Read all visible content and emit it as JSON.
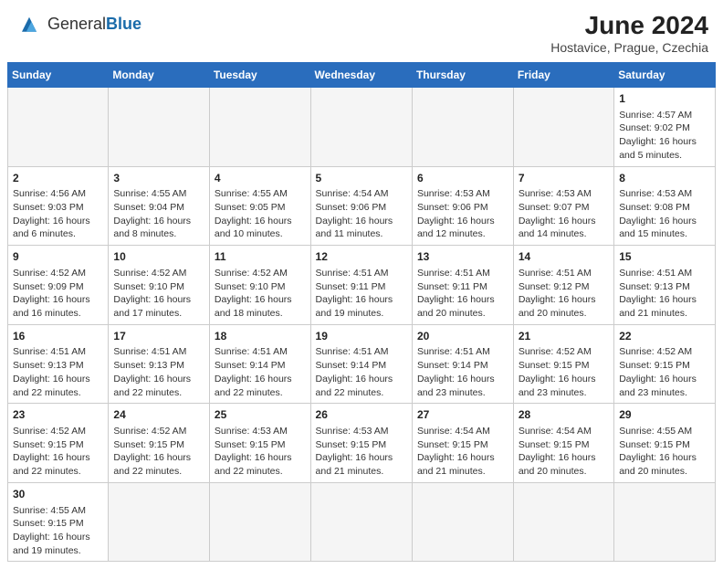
{
  "header": {
    "logo_general": "General",
    "logo_blue": "Blue",
    "month_year": "June 2024",
    "location": "Hostavice, Prague, Czechia"
  },
  "days_of_week": [
    "Sunday",
    "Monday",
    "Tuesday",
    "Wednesday",
    "Thursday",
    "Friday",
    "Saturday"
  ],
  "weeks": [
    [
      {
        "day": "",
        "info": ""
      },
      {
        "day": "",
        "info": ""
      },
      {
        "day": "",
        "info": ""
      },
      {
        "day": "",
        "info": ""
      },
      {
        "day": "",
        "info": ""
      },
      {
        "day": "",
        "info": ""
      },
      {
        "day": "1",
        "info": "Sunrise: 4:57 AM\nSunset: 9:02 PM\nDaylight: 16 hours and 5 minutes."
      }
    ],
    [
      {
        "day": "2",
        "info": "Sunrise: 4:56 AM\nSunset: 9:03 PM\nDaylight: 16 hours and 6 minutes."
      },
      {
        "day": "3",
        "info": "Sunrise: 4:55 AM\nSunset: 9:04 PM\nDaylight: 16 hours and 8 minutes."
      },
      {
        "day": "4",
        "info": "Sunrise: 4:55 AM\nSunset: 9:05 PM\nDaylight: 16 hours and 10 minutes."
      },
      {
        "day": "5",
        "info": "Sunrise: 4:54 AM\nSunset: 9:06 PM\nDaylight: 16 hours and 11 minutes."
      },
      {
        "day": "6",
        "info": "Sunrise: 4:53 AM\nSunset: 9:06 PM\nDaylight: 16 hours and 12 minutes."
      },
      {
        "day": "7",
        "info": "Sunrise: 4:53 AM\nSunset: 9:07 PM\nDaylight: 16 hours and 14 minutes."
      },
      {
        "day": "8",
        "info": "Sunrise: 4:53 AM\nSunset: 9:08 PM\nDaylight: 16 hours and 15 minutes."
      }
    ],
    [
      {
        "day": "9",
        "info": "Sunrise: 4:52 AM\nSunset: 9:09 PM\nDaylight: 16 hours and 16 minutes."
      },
      {
        "day": "10",
        "info": "Sunrise: 4:52 AM\nSunset: 9:10 PM\nDaylight: 16 hours and 17 minutes."
      },
      {
        "day": "11",
        "info": "Sunrise: 4:52 AM\nSunset: 9:10 PM\nDaylight: 16 hours and 18 minutes."
      },
      {
        "day": "12",
        "info": "Sunrise: 4:51 AM\nSunset: 9:11 PM\nDaylight: 16 hours and 19 minutes."
      },
      {
        "day": "13",
        "info": "Sunrise: 4:51 AM\nSunset: 9:11 PM\nDaylight: 16 hours and 20 minutes."
      },
      {
        "day": "14",
        "info": "Sunrise: 4:51 AM\nSunset: 9:12 PM\nDaylight: 16 hours and 20 minutes."
      },
      {
        "day": "15",
        "info": "Sunrise: 4:51 AM\nSunset: 9:13 PM\nDaylight: 16 hours and 21 minutes."
      }
    ],
    [
      {
        "day": "16",
        "info": "Sunrise: 4:51 AM\nSunset: 9:13 PM\nDaylight: 16 hours and 22 minutes."
      },
      {
        "day": "17",
        "info": "Sunrise: 4:51 AM\nSunset: 9:13 PM\nDaylight: 16 hours and 22 minutes."
      },
      {
        "day": "18",
        "info": "Sunrise: 4:51 AM\nSunset: 9:14 PM\nDaylight: 16 hours and 22 minutes."
      },
      {
        "day": "19",
        "info": "Sunrise: 4:51 AM\nSunset: 9:14 PM\nDaylight: 16 hours and 22 minutes."
      },
      {
        "day": "20",
        "info": "Sunrise: 4:51 AM\nSunset: 9:14 PM\nDaylight: 16 hours and 23 minutes."
      },
      {
        "day": "21",
        "info": "Sunrise: 4:52 AM\nSunset: 9:15 PM\nDaylight: 16 hours and 23 minutes."
      },
      {
        "day": "22",
        "info": "Sunrise: 4:52 AM\nSunset: 9:15 PM\nDaylight: 16 hours and 23 minutes."
      }
    ],
    [
      {
        "day": "23",
        "info": "Sunrise: 4:52 AM\nSunset: 9:15 PM\nDaylight: 16 hours and 22 minutes."
      },
      {
        "day": "24",
        "info": "Sunrise: 4:52 AM\nSunset: 9:15 PM\nDaylight: 16 hours and 22 minutes."
      },
      {
        "day": "25",
        "info": "Sunrise: 4:53 AM\nSunset: 9:15 PM\nDaylight: 16 hours and 22 minutes."
      },
      {
        "day": "26",
        "info": "Sunrise: 4:53 AM\nSunset: 9:15 PM\nDaylight: 16 hours and 21 minutes."
      },
      {
        "day": "27",
        "info": "Sunrise: 4:54 AM\nSunset: 9:15 PM\nDaylight: 16 hours and 21 minutes."
      },
      {
        "day": "28",
        "info": "Sunrise: 4:54 AM\nSunset: 9:15 PM\nDaylight: 16 hours and 20 minutes."
      },
      {
        "day": "29",
        "info": "Sunrise: 4:55 AM\nSunset: 9:15 PM\nDaylight: 16 hours and 20 minutes."
      }
    ],
    [
      {
        "day": "30",
        "info": "Sunrise: 4:55 AM\nSunset: 9:15 PM\nDaylight: 16 hours and 19 minutes."
      },
      {
        "day": "",
        "info": ""
      },
      {
        "day": "",
        "info": ""
      },
      {
        "day": "",
        "info": ""
      },
      {
        "day": "",
        "info": ""
      },
      {
        "day": "",
        "info": ""
      },
      {
        "day": "",
        "info": ""
      }
    ]
  ]
}
